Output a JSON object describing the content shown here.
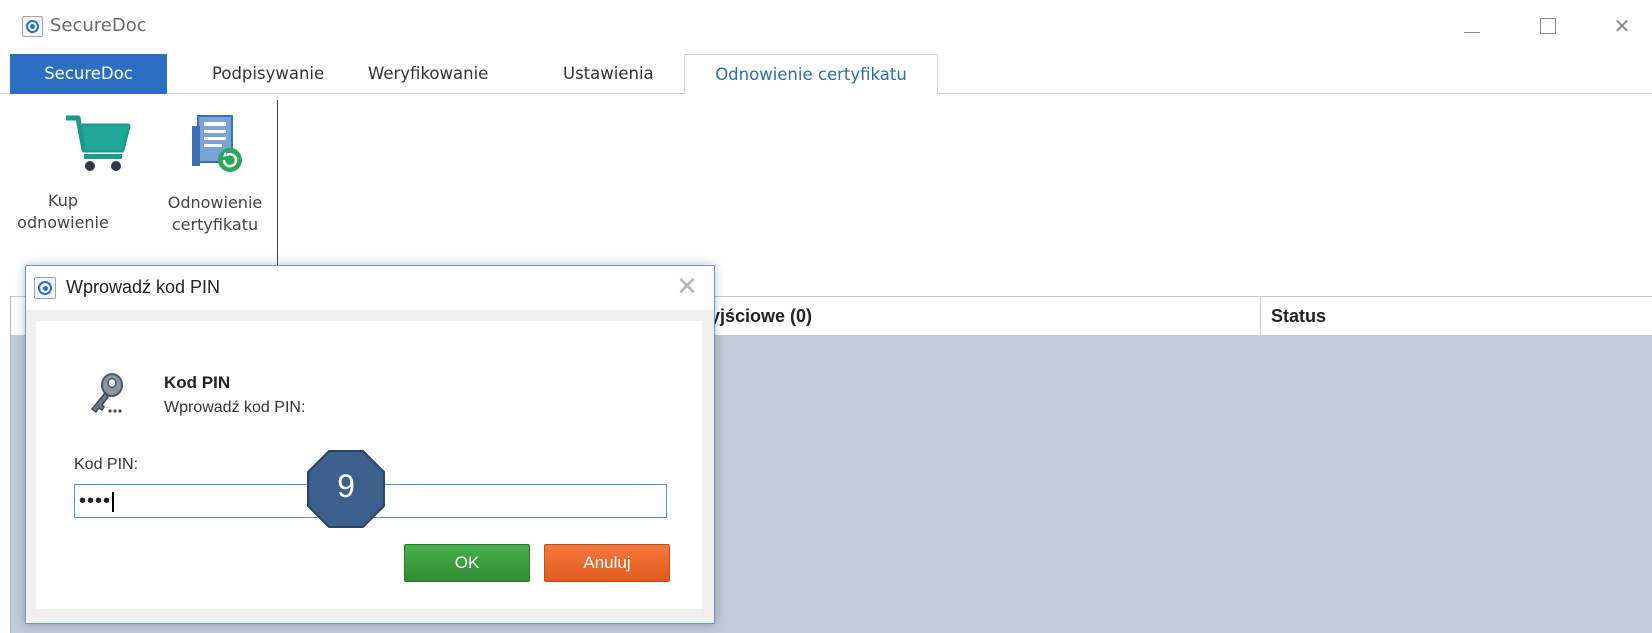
{
  "window": {
    "title": "SecureDoc",
    "icons": {
      "app": "app-icon",
      "minimize": "minimize-icon",
      "maximize": "maximize-icon",
      "close": "close-icon"
    }
  },
  "tabs": [
    {
      "label": "SecureDoc"
    },
    {
      "label": "Podpisywanie"
    },
    {
      "label": "Weryfikowanie"
    },
    {
      "label": "Ustawienia"
    },
    {
      "label": "Odnowienie certyfikatu"
    }
  ],
  "ribbon": {
    "buy_renewal": {
      "line1": "Kup",
      "line2": "odnowienie",
      "icon": "shopping-cart-icon"
    },
    "renew_cert": {
      "line1": "Odnowienie",
      "line2": "certyfikatu",
      "icon": "document-refresh-icon"
    }
  },
  "grid": {
    "columns": [
      {
        "label": "yjściowe (0)"
      },
      {
        "label": "Status"
      }
    ]
  },
  "dialog": {
    "title": "Wprowadź kod PIN",
    "heading": "Kod PIN",
    "subheading": "Wprowadź kod PIN:",
    "field_label": "Kod PIN:",
    "pin_value": "••••",
    "ok_label": "OK",
    "cancel_label": "Anuluj",
    "icons": {
      "key": "key-icon",
      "close": "close-icon"
    }
  },
  "step_badge": {
    "number": "9"
  },
  "colors": {
    "file_tab": "#2b6fc2",
    "active_tab_text": "#2b6fa8",
    "grid_background": "#c1ccd7",
    "ok_button": "#3a9e3d",
    "cancel_button": "#e8682b",
    "badge": "#3d5f8c"
  }
}
